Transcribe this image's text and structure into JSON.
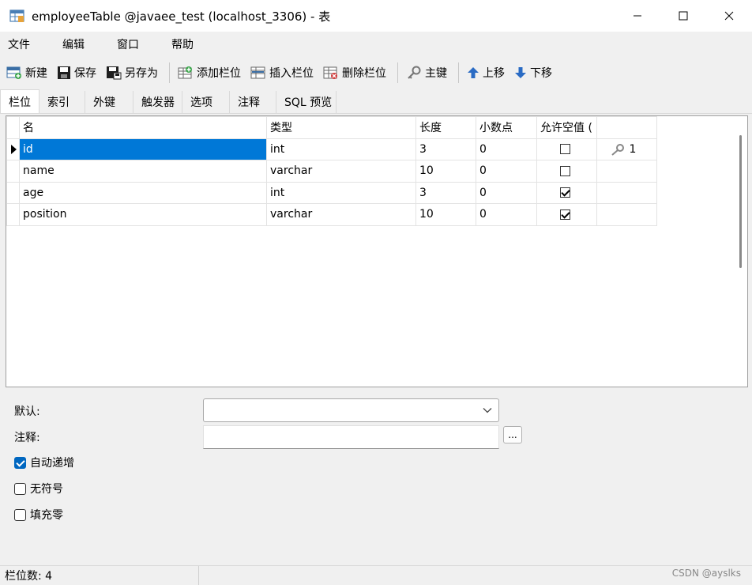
{
  "window": {
    "title": "employeeTable @javaee_test (localhost_3306) - 表"
  },
  "menu": [
    "文件",
    "编辑",
    "窗口",
    "帮助"
  ],
  "toolbar": {
    "new": "新建",
    "save": "保存",
    "save_as": "另存为",
    "add_field": "添加栏位",
    "insert_field": "插入栏位",
    "delete_field": "删除栏位",
    "primary_key": "主键",
    "move_up": "上移",
    "move_down": "下移"
  },
  "tabs": [
    "栏位",
    "索引",
    "外键",
    "触发器",
    "选项",
    "注释",
    "SQL 预览"
  ],
  "grid": {
    "headers": [
      "名",
      "类型",
      "长度",
      "小数点",
      "允许空值 (",
      ""
    ],
    "rows": [
      {
        "name": "id",
        "type": "int",
        "length": "3",
        "decimals": "0",
        "nullable": false,
        "key": "1"
      },
      {
        "name": "name",
        "type": "varchar",
        "length": "10",
        "decimals": "0",
        "nullable": false,
        "key": ""
      },
      {
        "name": "age",
        "type": "int",
        "length": "3",
        "decimals": "0",
        "nullable": true,
        "key": ""
      },
      {
        "name": "position",
        "type": "varchar",
        "length": "10",
        "decimals": "0",
        "nullable": true,
        "key": ""
      }
    ]
  },
  "props": {
    "default_label": "默认:",
    "comment_label": "注释:",
    "default_value": "",
    "comment_value": "",
    "ellipsis": "...",
    "auto_increment_label": "自动递增",
    "auto_increment": true,
    "unsigned_label": "无符号",
    "unsigned": false,
    "zerofill_label": "填充零",
    "zerofill": false
  },
  "status": {
    "field_count": "栏位数: 4",
    "watermark": "CSDN @ayslks"
  }
}
